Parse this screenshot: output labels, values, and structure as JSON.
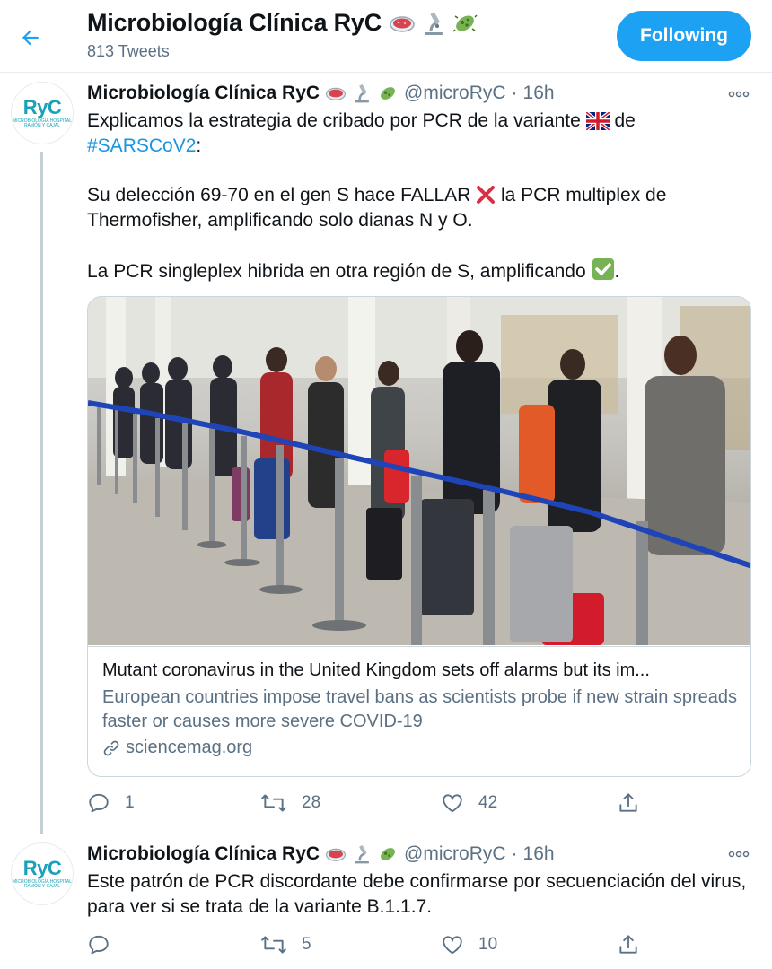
{
  "header": {
    "title": "Microbiología Clínica RyC",
    "tweet_count": "813 Tweets",
    "follow_label": "Following"
  },
  "tweets": [
    {
      "name": "Microbiología Clínica RyC",
      "handle": "@microRyC",
      "dot": "·",
      "time": "16h",
      "avatar_text": "RyC",
      "avatar_subtext": "MICROBIOLOGÍA HOSPITAL RAMÓN Y CAJAL",
      "text_1a": "Explicamos la estrategia de cribado por PCR de la variante",
      "text_1b": "de",
      "hashtag": "#SARSCoV2",
      "text_1c": ":",
      "text_2a": "Su delección 69-70 en el gen S hace FALLAR",
      "text_2b": "la PCR multiplex de Thermofisher, amplificando solo dianas N y O.",
      "text_3a": "La PCR singleplex hibrida en otra región de S, amplificando",
      "text_3b": ".",
      "card": {
        "title": "Mutant coronavirus in the United Kingdom sets off alarms but its im...",
        "description": "European countries impose travel bans as scientists probe if new strain spreads faster or causes more severe COVID-19",
        "domain": "sciencemag.org"
      },
      "stats": {
        "replies": "1",
        "retweets": "28",
        "likes": "42"
      }
    },
    {
      "name": "Microbiología Clínica RyC",
      "handle": "@microRyC",
      "dot": "·",
      "time": "16h",
      "avatar_text": "RyC",
      "avatar_subtext": "MICROBIOLOGÍA HOSPITAL RAMÓN Y CAJAL",
      "text": "Este patrón de PCR discordante debe confirmarse por secuenciación del virus, para ver si se trata de la variante B.1.1.7.",
      "stats": {
        "replies": "",
        "retweets": "5",
        "likes": "10"
      }
    }
  ],
  "colors": {
    "accent": "#1da1f2",
    "link": "#1b95e0",
    "secondary_text": "#5b7083",
    "border": "#ccd6dd"
  },
  "icons": [
    "back-arrow-icon",
    "petri-dish-emoji",
    "microscope-emoji",
    "microbe-emoji",
    "uk-flag-emoji",
    "cross-mark-emoji",
    "check-mark-emoji",
    "more-icon",
    "link-icon",
    "reply-icon",
    "retweet-icon",
    "like-icon",
    "share-icon"
  ]
}
